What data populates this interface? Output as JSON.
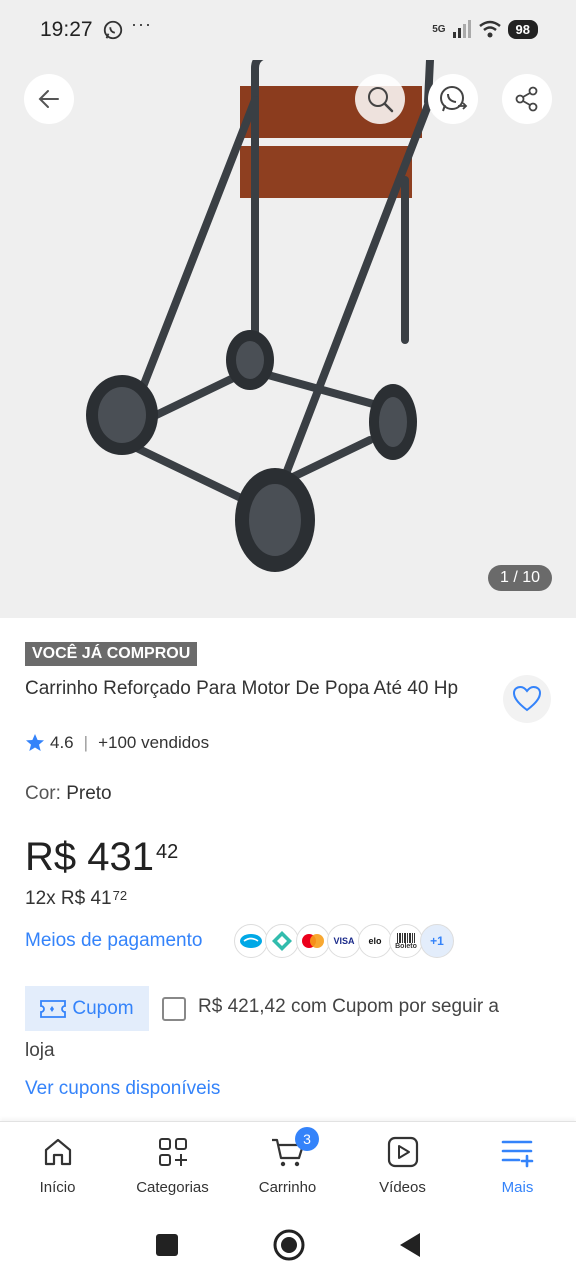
{
  "status_bar": {
    "time": "19:27",
    "dots": "···",
    "network": "5G",
    "battery": "98"
  },
  "product_gallery": {
    "counter": "1 / 10"
  },
  "product": {
    "badge": "VOCÊ JÁ COMPROU",
    "title": "Carrinho Reforçado Para Motor De Popa Até 40 Hp",
    "rating": "4.6",
    "sold": "+100 vendidos",
    "color_label": "Cor:",
    "color_value": "Preto",
    "price_main": "R$ 431",
    "price_cents": "42",
    "installments_prefix": "12x R$ 41",
    "installments_cents": "72",
    "payment_link": "Meios de pagamento",
    "payment_icons": [
      "mercado-pago",
      "pix",
      "mastercard",
      "visa",
      "elo",
      "boleto"
    ],
    "payment_visa": "VISA",
    "payment_elo": "elo",
    "payment_boleto": "Boleto",
    "payment_more": "+1"
  },
  "coupon": {
    "button_label": "Cupom",
    "text_line1": "R$ 421,42 com Cupom por seguir a",
    "text_line2": "loja",
    "see_all": "Ver cupons disponíveis"
  },
  "bottom_nav": {
    "items": [
      {
        "label": "Início",
        "icon": "home-icon"
      },
      {
        "label": "Categorias",
        "icon": "categories-icon"
      },
      {
        "label": "Carrinho",
        "icon": "cart-icon",
        "badge": "3"
      },
      {
        "label": "Vídeos",
        "icon": "video-icon"
      },
      {
        "label": "Mais",
        "icon": "more-icon",
        "active": true
      }
    ]
  },
  "colors": {
    "accent": "#3483fa",
    "badge_bg": "#6b6b6b",
    "hero_bg": "#efefef"
  }
}
